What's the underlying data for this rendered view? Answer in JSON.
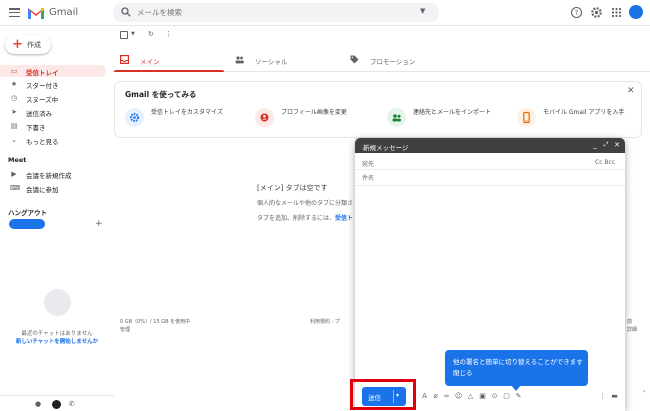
{
  "header": {
    "brand": "Gmail",
    "search": {
      "placeholder": "メールを検索"
    },
    "colors": {
      "accent": "#1a73e8",
      "brand_red": "#ea4335"
    }
  },
  "sidebar": {
    "compose_label": "作成",
    "items": [
      {
        "label": "受信トレイ",
        "icon": "inbox-icon",
        "active": true
      },
      {
        "label": "スター付き",
        "icon": "star-icon"
      },
      {
        "label": "スヌーズ中",
        "icon": "clock-icon"
      },
      {
        "label": "送信済み",
        "icon": "send-icon"
      },
      {
        "label": "下書き",
        "icon": "draft-icon"
      },
      {
        "label": "もっと見る",
        "icon": "chevron-down-icon"
      }
    ],
    "meet": {
      "title": "Meet",
      "items": [
        {
          "label": "会議を新規作成",
          "icon": "video-icon"
        },
        {
          "label": "会議に参加",
          "icon": "keyboard-icon"
        }
      ]
    },
    "hangouts": {
      "title": "ハングアウト",
      "empty_text": "最近のチャットはありません",
      "empty_link": "新しいチャットを開始しませんか"
    }
  },
  "main": {
    "tabs": [
      {
        "label": "メイン",
        "icon": "inbox-icon",
        "active": true
      },
      {
        "label": "ソーシャル",
        "icon": "people-icon"
      },
      {
        "label": "プロモーション",
        "icon": "tag-icon"
      }
    ],
    "getting_started": {
      "title": "Gmail を使ってみる",
      "items": [
        {
          "label": "受信トレイをカスタマイズ",
          "icon": "settings-icon"
        },
        {
          "label": "プロフィール画像を変更",
          "icon": "profile-icon"
        },
        {
          "label": "連絡先とメールをインポート",
          "icon": "import-contacts-icon"
        },
        {
          "label": "モバイル Gmail アプリを入手",
          "icon": "mobile-icon"
        }
      ]
    },
    "empty": {
      "title": "[メイン] タブは空です",
      "line1": "個人的なメールや他のタブに分類さ",
      "line2_prefix": "タブを追加、削除するには、",
      "line2_link": "受信ト"
    },
    "footer": {
      "storage": "0 GB（0%）/ 15 GB を使用中",
      "manage": "管理",
      "terms": "利用規約 · プ",
      "right1": "前",
      "right2": "詳細"
    }
  },
  "compose": {
    "title": "新規メッセージ",
    "to_label": "宛先",
    "cc_bcc": "Cc Bcc",
    "subject_placeholder": "件名",
    "send_label": "送信",
    "tooltip_line1": "他の署名と簡単に切り替えることができます",
    "tooltip_line2": "閉じる"
  }
}
